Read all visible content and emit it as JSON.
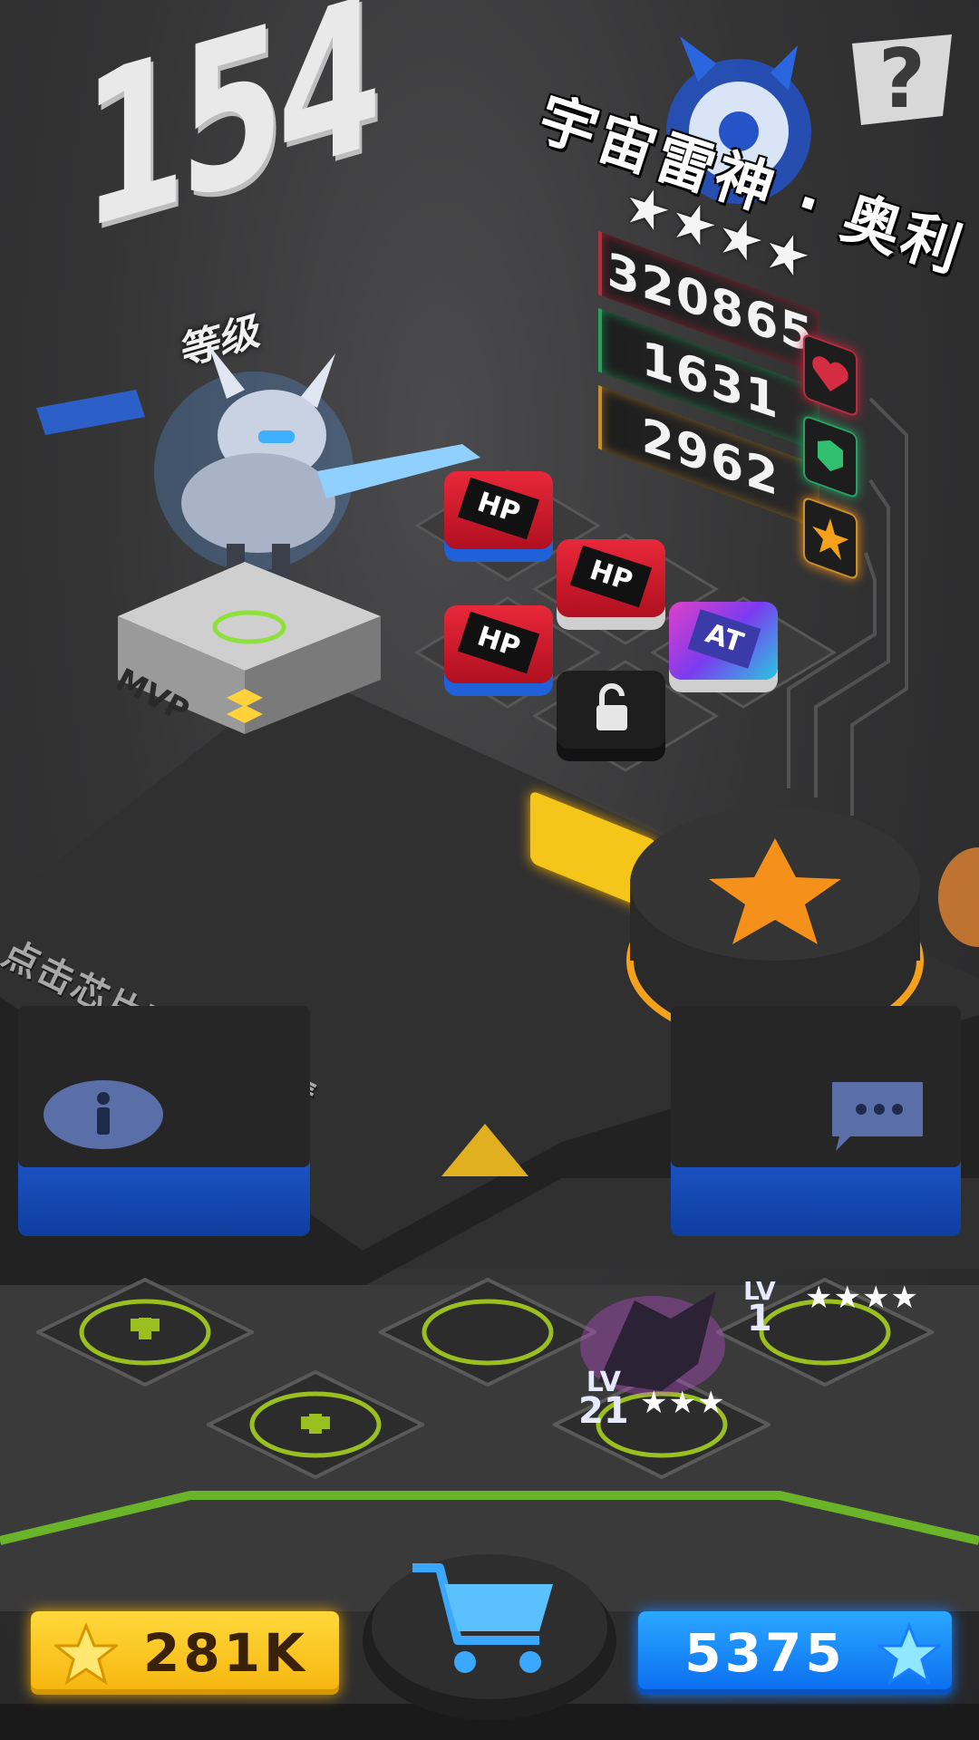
{
  "level": {
    "value": "154",
    "label": "等级"
  },
  "hero": {
    "name": "宇宙雷神 · 奥利",
    "stars": "★★★★",
    "mvp_label": "MVP"
  },
  "stats": {
    "hp": "320865",
    "defense": "1631",
    "attack": "2962"
  },
  "chips": {
    "hp_chip_label": "HP",
    "atk_chip_label": "AT"
  },
  "hint": "点击芯片可查看详情",
  "team": [
    {
      "lv_label": "LV",
      "lv_value": "1",
      "stars": "★★★★"
    },
    {
      "lv_label": "LV",
      "lv_value": "21",
      "stars": "★★★"
    }
  ],
  "currency": {
    "gold": "281K",
    "gems": "5375"
  },
  "colors": {
    "gold": "#f6b40e",
    "blue": "#0a6cf0",
    "orange": "#f5901a",
    "hp_red": "#c8203a",
    "def_green": "#2aa060"
  },
  "icons": [
    "help-icon",
    "heart-icon",
    "shield-icon",
    "star-icon",
    "lock-icon",
    "info-icon",
    "chat-icon",
    "cart-icon",
    "plus-icon",
    "arrow-up-icon"
  ]
}
